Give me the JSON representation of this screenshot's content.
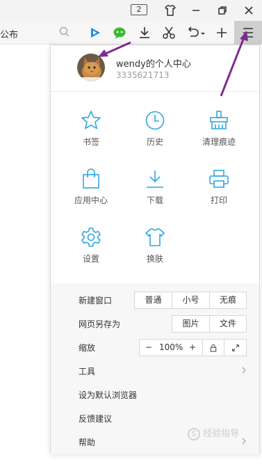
{
  "titlebar": {
    "tab_count": "2",
    "icons": [
      "skin-shirt-icon",
      "minimize-icon",
      "restore-icon",
      "close-icon"
    ]
  },
  "toolbar": {
    "partial_text": "公布",
    "icons": [
      "search-icon",
      "video-play-icon",
      "wechat-icon",
      "download-icon",
      "scissors-icon",
      "undo-icon",
      "add-icon",
      "menu-icon"
    ]
  },
  "user": {
    "name": "wendy的个人中心",
    "id": "3335621713"
  },
  "grid": [
    {
      "label": "书签",
      "icon": "star-icon"
    },
    {
      "label": "历史",
      "icon": "clock-icon"
    },
    {
      "label": "清理痕迹",
      "icon": "broom-icon"
    },
    {
      "label": "应用中心",
      "icon": "bag-icon"
    },
    {
      "label": "下载",
      "icon": "download-icon"
    },
    {
      "label": "打印",
      "icon": "printer-icon"
    },
    {
      "label": "设置",
      "icon": "gear-icon"
    },
    {
      "label": "换肤",
      "icon": "shirt-icon"
    }
  ],
  "settings": {
    "new_window": {
      "label": "新建窗口",
      "options": [
        "普通",
        "小号",
        "无痕"
      ]
    },
    "save_as": {
      "label": "网页另存为",
      "options": [
        "图片",
        "文件"
      ]
    },
    "zoom": {
      "label": "缩放",
      "minus": "−",
      "value": "100%",
      "plus": "+"
    },
    "tools": {
      "label": "工具"
    },
    "default_browser": {
      "label": "设为默认浏览器"
    },
    "feedback": {
      "label": "反馈建议"
    },
    "help": {
      "label": "帮助"
    }
  },
  "watermark": {
    "glyph": "S",
    "text": "经验指导"
  },
  "colors": {
    "accent": "#2fa6e0",
    "arrow": "#7b2d8e"
  }
}
